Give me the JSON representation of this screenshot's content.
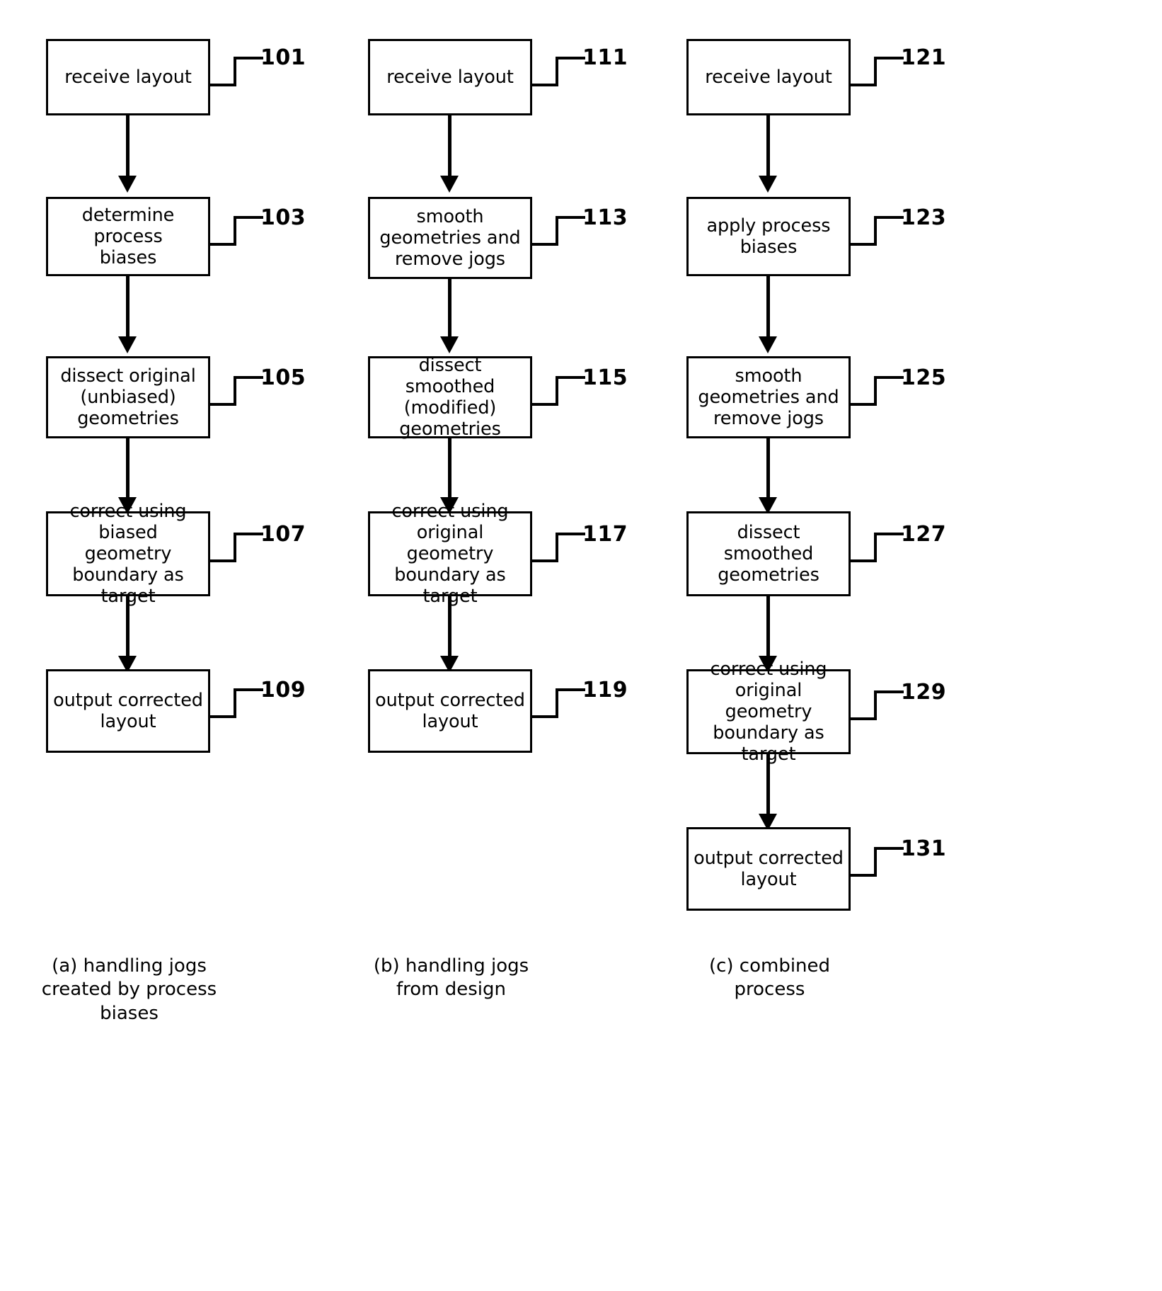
{
  "figure": {
    "title": "",
    "columns": [
      {
        "id": "a",
        "caption_lines": [
          "(a) handling jogs",
          "created by",
          "process biases"
        ],
        "nodes": [
          {
            "ref": "101",
            "lines": [
              "receive layout"
            ]
          },
          {
            "ref": "103",
            "lines": [
              "determine process",
              "biases"
            ]
          },
          {
            "ref": "105",
            "lines": [
              "dissect original",
              "(unbiased)",
              "geometries"
            ]
          },
          {
            "ref": "107",
            "lines": [
              "correct using",
              "biased geometry",
              "boundary as target"
            ]
          },
          {
            "ref": "109",
            "lines": [
              "output corrected",
              "layout"
            ]
          }
        ]
      },
      {
        "id": "b",
        "caption_lines": [
          "(b) handling jogs",
          "from design"
        ],
        "nodes": [
          {
            "ref": "111",
            "lines": [
              "receive layout"
            ]
          },
          {
            "ref": "113",
            "lines": [
              "smooth",
              "geometries and",
              "remove jogs"
            ]
          },
          {
            "ref": "115",
            "lines": [
              "dissect smoothed",
              "(modified)",
              "geometries"
            ]
          },
          {
            "ref": "117",
            "lines": [
              "correct using",
              "original geometry",
              "boundary as target"
            ]
          },
          {
            "ref": "119",
            "lines": [
              "output corrected",
              "layout"
            ]
          }
        ]
      },
      {
        "id": "c",
        "caption_lines": [
          "(c) combined",
          "process"
        ],
        "nodes": [
          {
            "ref": "121",
            "lines": [
              "receive layout"
            ]
          },
          {
            "ref": "123",
            "lines": [
              "apply process",
              "biases"
            ]
          },
          {
            "ref": "125",
            "lines": [
              "smooth",
              "geometries and",
              "remove jogs"
            ]
          },
          {
            "ref": "127",
            "lines": [
              "dissect smoothed",
              "geometries"
            ]
          },
          {
            "ref": "129",
            "lines": [
              "correct using",
              "original geometry",
              "boundary as target"
            ]
          },
          {
            "ref": "131",
            "lines": [
              "output corrected",
              "layout"
            ]
          }
        ]
      }
    ],
    "colors": {
      "ink": "#000000",
      "paper": "#ffffff"
    }
  }
}
